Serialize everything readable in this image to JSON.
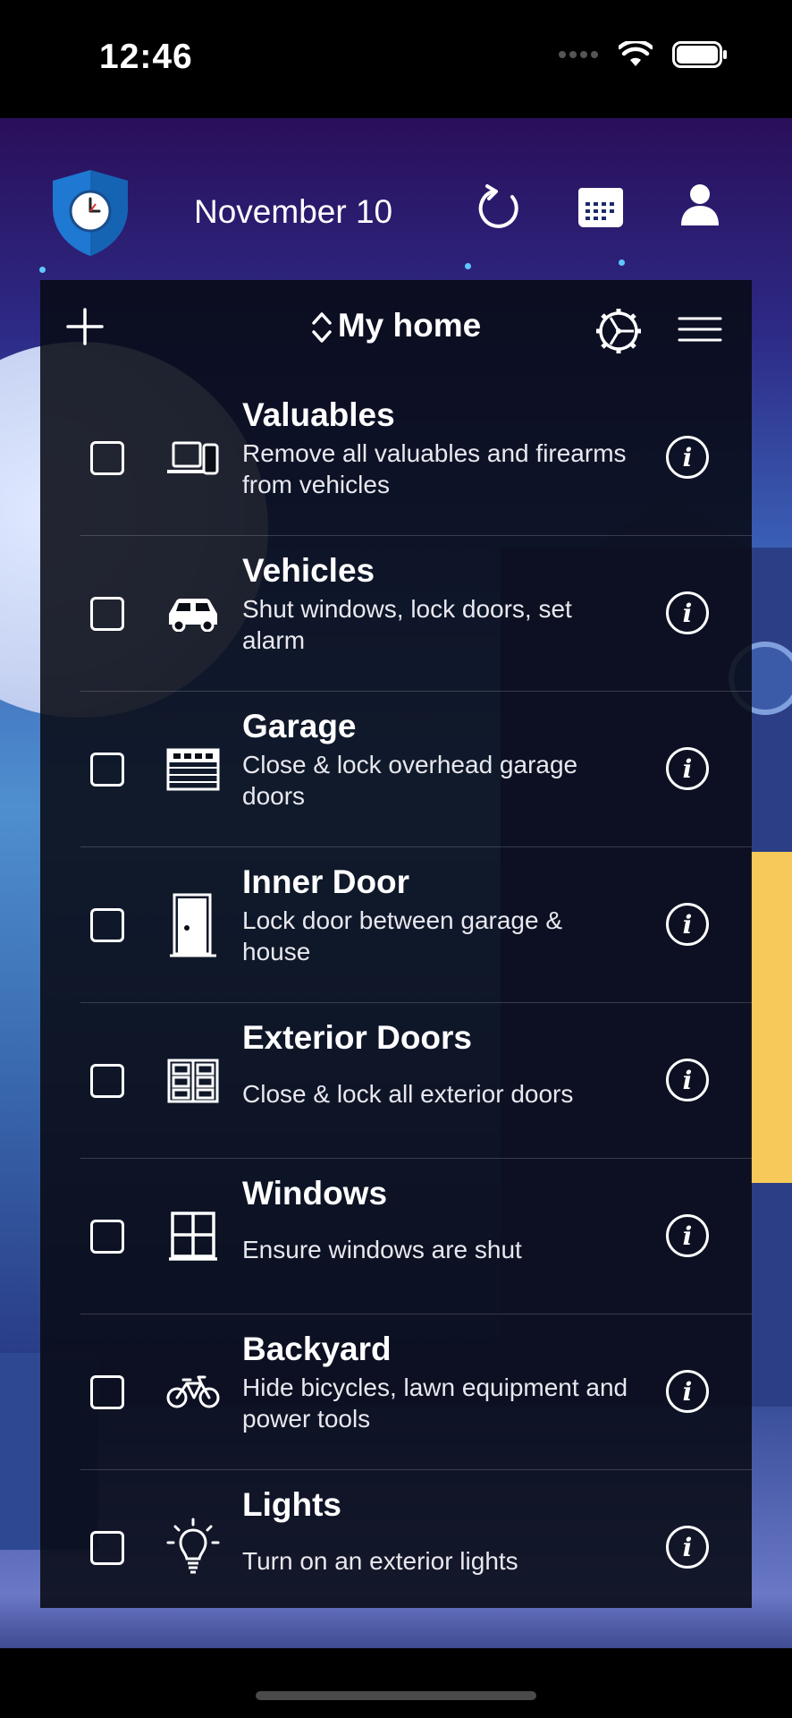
{
  "status_bar": {
    "time": "12:46"
  },
  "header": {
    "date": "November 10"
  },
  "panel": {
    "title": "My home",
    "items": [
      {
        "title": "Valuables",
        "description": "Remove all valuables and firearms from vehicles",
        "icon": "laptop-phone-icon",
        "checked": false
      },
      {
        "title": "Vehicles",
        "description": "Shut windows, lock doors, set alarm",
        "icon": "car-icon",
        "checked": false
      },
      {
        "title": "Garage",
        "description": "Close & lock overhead garage doors",
        "icon": "garage-icon",
        "checked": false
      },
      {
        "title": "Inner Door",
        "description": "Lock door between garage & house",
        "icon": "door-icon",
        "checked": false
      },
      {
        "title": "Exterior Doors",
        "description": "Close & lock all exterior doors",
        "icon": "double-door-icon",
        "checked": false
      },
      {
        "title": "Windows",
        "description": "Ensure windows are shut",
        "icon": "window-icon",
        "checked": false
      },
      {
        "title": "Backyard",
        "description": "Hide bicycles, lawn equipment and power tools",
        "icon": "bicycle-icon",
        "checked": false
      },
      {
        "title": "Lights",
        "description": "Turn on an exterior lights",
        "icon": "lightbulb-icon",
        "checked": false
      }
    ]
  },
  "colors": {
    "shield": "#1f78d1",
    "panel_background": "#080a14",
    "window_light": "#f6c95a"
  }
}
